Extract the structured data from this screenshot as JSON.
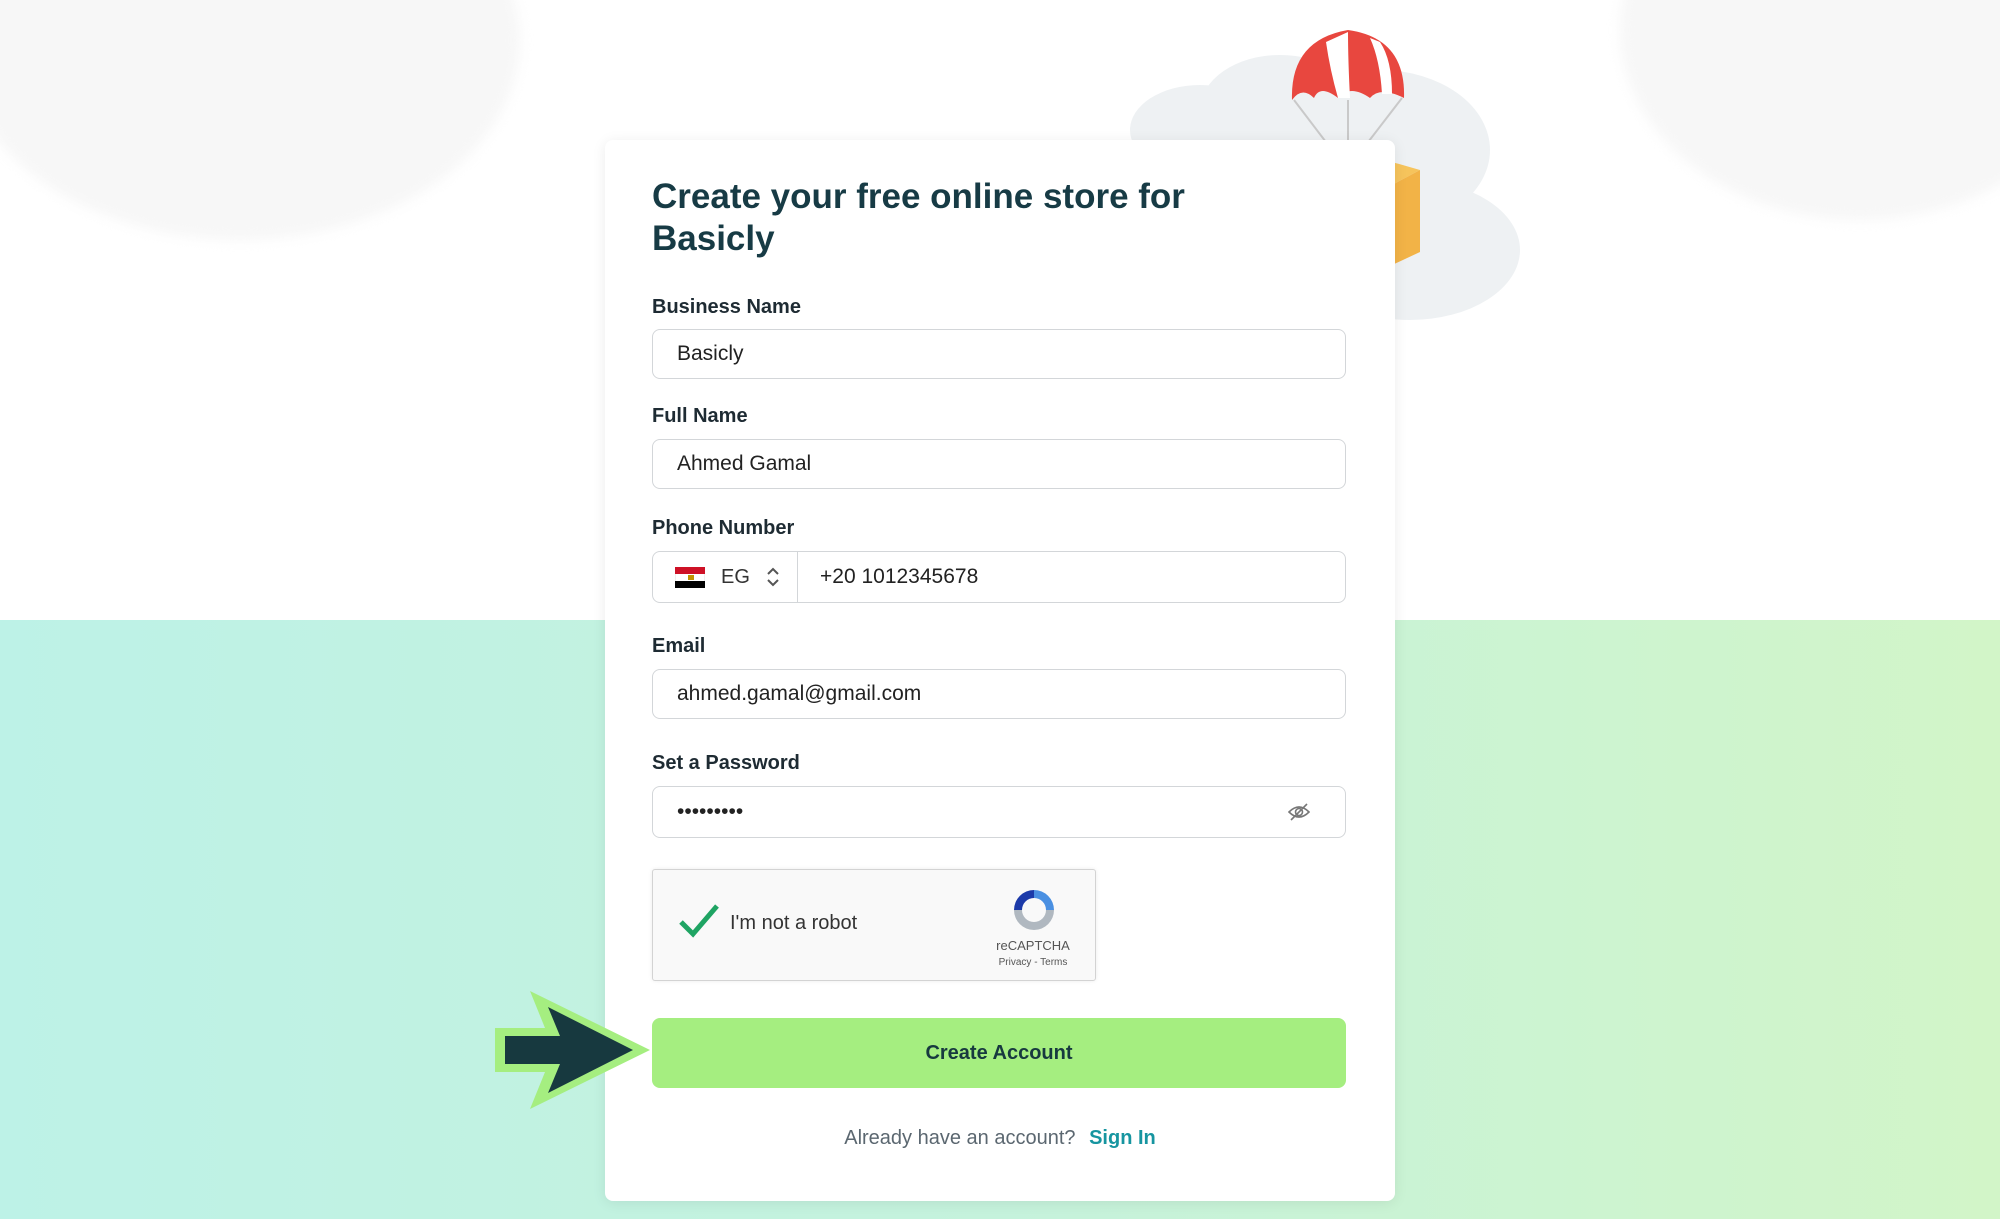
{
  "form": {
    "title": "Create your free online store for Basicly",
    "business_name": {
      "label": "Business Name",
      "value": "Basicly"
    },
    "full_name": {
      "label": "Full Name",
      "value": "Ahmed Gamal"
    },
    "phone": {
      "label": "Phone Number",
      "country_code": "EG",
      "value": "+20 1012345678"
    },
    "email": {
      "label": "Email",
      "value": "ahmed.gamal@gmail.com"
    },
    "password": {
      "label": "Set a Password",
      "value": "•••••••••"
    },
    "captcha": {
      "text": "I'm not a robot",
      "brand": "reCAPTCHA",
      "links": "Privacy - Terms",
      "checked": true
    },
    "submit_label": "Create Account",
    "signin_prompt": "Already have an account?",
    "signin_link": "Sign In"
  },
  "colors": {
    "title": "#173b45",
    "button_bg": "#a5ee80",
    "link": "#1695a0",
    "check": "#1fa463"
  }
}
